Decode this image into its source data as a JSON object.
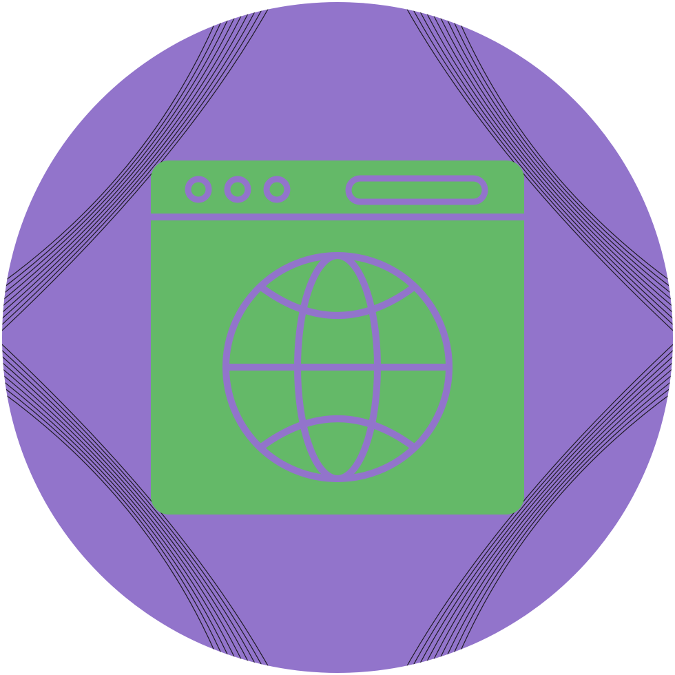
{
  "icon": {
    "name": "web-browser-globe-icon",
    "window_controls": [
      "dot",
      "dot",
      "dot"
    ],
    "address_bar": "rounded-pill"
  },
  "colors": {
    "background_circle": "#9274CB",
    "browser_window": "#64B968",
    "outline": "#9274CB",
    "hatch_lines": "#1E1A24",
    "page": "#FFFFFF"
  }
}
